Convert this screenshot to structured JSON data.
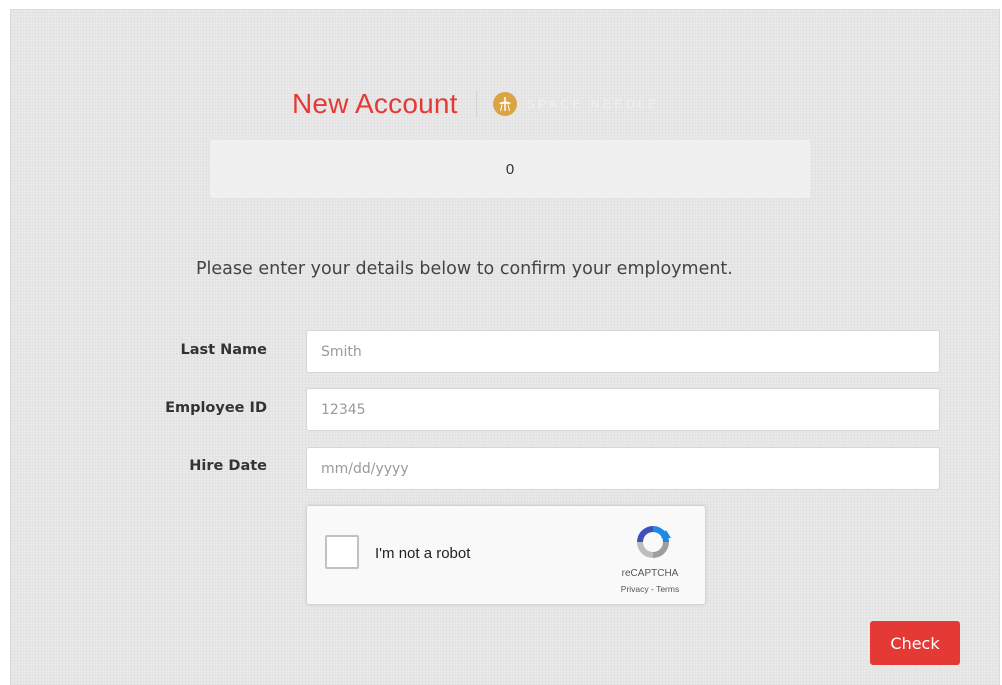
{
  "header": {
    "title": "New Account",
    "logo_text": "SPACE NEEDLE"
  },
  "status": {
    "text": "0"
  },
  "instructions": "Please enter your details below to confirm your employment.",
  "form": {
    "last_name": {
      "label": "Last Name",
      "placeholder": "Smith",
      "value": ""
    },
    "employee_id": {
      "label": "Employee ID",
      "placeholder": "12345",
      "value": ""
    },
    "hire_date": {
      "label": "Hire Date",
      "placeholder": "mm/dd/yyyy",
      "value": ""
    }
  },
  "recaptcha": {
    "label": "I'm not a robot",
    "brand": "reCAPTCHA",
    "links": "Privacy - Terms",
    "checked": false
  },
  "check_button": {
    "label": "Check"
  },
  "colors": {
    "accent": "#e53935",
    "logo": "#d9a441"
  },
  "icons": {
    "logo": "space-needle-logo-icon",
    "recaptcha": "recaptcha-logo-icon"
  }
}
